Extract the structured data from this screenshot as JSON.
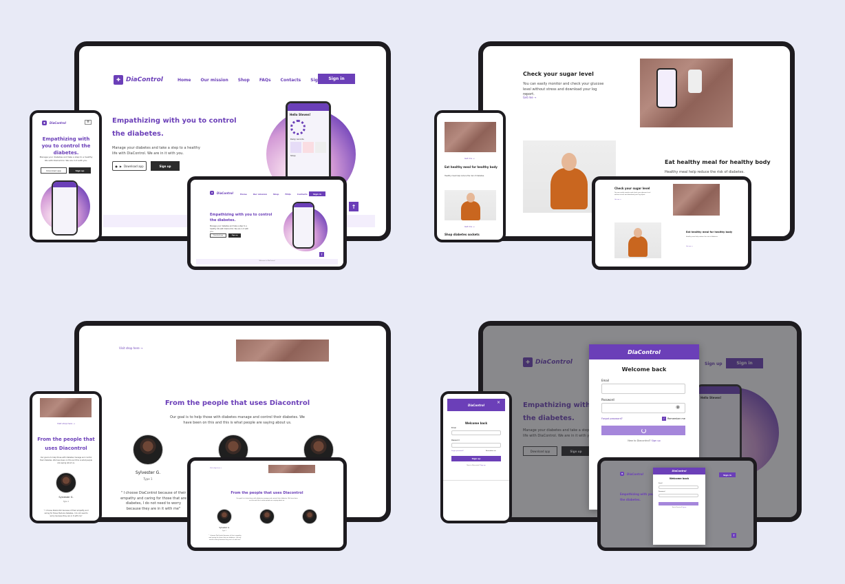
{
  "brand": {
    "name": "DiaControl",
    "accent": "#6b3fb8",
    "dark": "#2b2b2b",
    "background": "#e8eaf6"
  },
  "nav": {
    "items": [
      "Home",
      "Our mission",
      "Shop",
      "FAQs",
      "Contacts",
      "Sign up"
    ],
    "signin": "Sign in"
  },
  "hero": {
    "title_line1": "Empathizing with you to control",
    "title_line2": "the diabetes.",
    "mobile_title": "Empathizing with you to control the diabetes.",
    "body": "Manage your diabetes and take a step to a healthy life with DiaControl. We are in it with you.",
    "download": "Download app",
    "signup": "Sign up"
  },
  "phone_app": {
    "greeting": "Hello Steven!",
    "daily_records": "Daily records",
    "shop": "Shop",
    "see_all": "See all"
  },
  "sugar": {
    "title": "Check your sugar level",
    "body": "You can easily monitor and check your glucose level without stress and download your log report.",
    "link": "Get me"
  },
  "meal": {
    "title": "Eat healthy meal for healthy body",
    "body": "Healthy meal help reduce the risk of diabetes.",
    "link": "Get me",
    "shop_title": "Shop diabetes sockets"
  },
  "testimonials": {
    "title": "From the people that uses Diacontrol",
    "mobile_title_l1": "From the people that",
    "mobile_title_l2": "uses Diacontrol",
    "intro": "Our goal is to help those with diabetes manage and control their diabetes. We have been on this and this is what people are saying about us.",
    "shop_link": "Visit shop here",
    "people": [
      {
        "name": "Sylvester G.",
        "type": "Type 1",
        "quote": "\" I choose DiaControl because of their empathy and caring for those that are diabetes, I do not need to worry because they are in it with me\""
      }
    ]
  },
  "login": {
    "brand": "DiaControl",
    "title": "Welcome back",
    "email_label": "Email",
    "password_label": "Password",
    "forgot": "Forgot password?",
    "remember": "Remember me",
    "new_prompt": "New to Diacontrol?",
    "signup_link": "Sign up",
    "close": "×"
  },
  "laptop_footer": "Welcome to DiaControl"
}
